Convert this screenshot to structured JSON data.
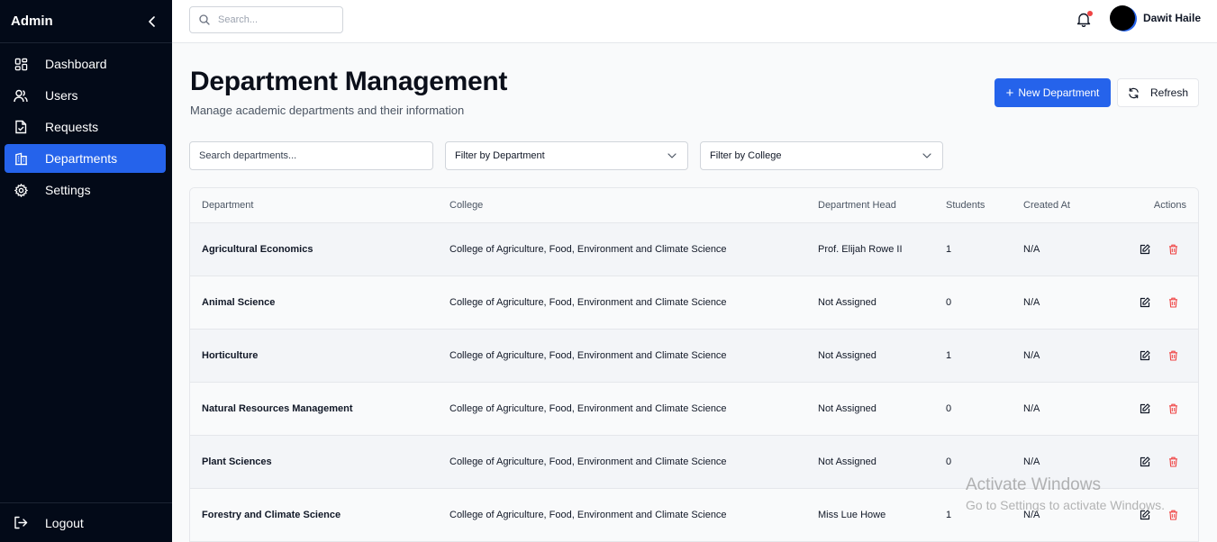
{
  "sidebar": {
    "title": "Admin",
    "items": [
      {
        "label": "Dashboard",
        "icon": "dashboard-icon"
      },
      {
        "label": "Users",
        "icon": "users-icon"
      },
      {
        "label": "Requests",
        "icon": "requests-icon"
      },
      {
        "label": "Departments",
        "icon": "building-icon",
        "active": true
      },
      {
        "label": "Settings",
        "icon": "gear-icon"
      }
    ],
    "logout_label": "Logout"
  },
  "topbar": {
    "search_placeholder": "Search...",
    "user_name": "Dawit Haile",
    "notification_dot_color": "#ef4444"
  },
  "page": {
    "title": "Department Management",
    "subtitle": "Manage academic departments and their information",
    "new_button": "New Department",
    "refresh_button": "Refresh",
    "accent_color": "#2563eb"
  },
  "filters": {
    "search_placeholder": "Search departments...",
    "department_select": "Filter by Department",
    "college_select": "Filter by College"
  },
  "table": {
    "columns": [
      "Department",
      "College",
      "Department Head",
      "Students",
      "Created At",
      "Actions"
    ],
    "rows": [
      {
        "department": "Agricultural Economics",
        "college": "College of Agriculture, Food, Environment and Climate Science",
        "head": "Prof. Elijah Rowe II",
        "students": "1",
        "created": "N/A"
      },
      {
        "department": "Animal Science",
        "college": "College of Agriculture, Food, Environment and Climate Science",
        "head": "Not Assigned",
        "students": "0",
        "created": "N/A"
      },
      {
        "department": "Horticulture",
        "college": "College of Agriculture, Food, Environment and Climate Science",
        "head": "Not Assigned",
        "students": "1",
        "created": "N/A"
      },
      {
        "department": "Natural Resources Management",
        "college": "College of Agriculture, Food, Environment and Climate Science",
        "head": "Not Assigned",
        "students": "0",
        "created": "N/A"
      },
      {
        "department": "Plant Sciences",
        "college": "College of Agriculture, Food, Environment and Climate Science",
        "head": "Not Assigned",
        "students": "0",
        "created": "N/A"
      },
      {
        "department": "Forestry and Climate Science",
        "college": "College of Agriculture, Food, Environment and Climate Science",
        "head": "Miss Lue Howe",
        "students": "1",
        "created": "N/A"
      }
    ]
  },
  "watermark": {
    "line1": "Activate Windows",
    "line2": "Go to Settings to activate Windows."
  }
}
